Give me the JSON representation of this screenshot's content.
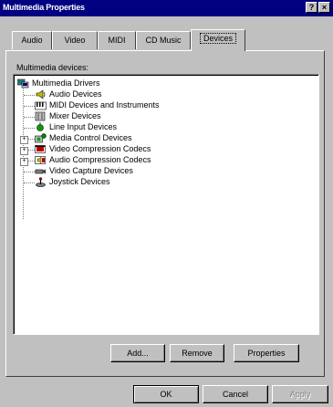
{
  "window": {
    "title": "Multimedia Properties",
    "help_label": "?",
    "close_label": "×"
  },
  "tabs": [
    {
      "label": "Audio"
    },
    {
      "label": "Video"
    },
    {
      "label": "MIDI"
    },
    {
      "label": "CD Music"
    },
    {
      "label": "Devices"
    }
  ],
  "active_tab": "Devices",
  "devices": {
    "label": "Multimedia devices:",
    "root": {
      "label": "Multimedia Drivers",
      "icon": "multimedia-drivers-icon"
    },
    "items": [
      {
        "label": "Audio Devices",
        "icon": "speaker-icon",
        "expandable": false
      },
      {
        "label": "MIDI Devices and Instruments",
        "icon": "midi-keyboard-icon",
        "expandable": false
      },
      {
        "label": "Mixer Devices",
        "icon": "mixer-icon",
        "expandable": false
      },
      {
        "label": "Line Input Devices",
        "icon": "line-input-icon",
        "expandable": false
      },
      {
        "label": "Media Control Devices",
        "icon": "media-control-icon",
        "expandable": true
      },
      {
        "label": "Video Compression Codecs",
        "icon": "video-codec-icon",
        "expandable": true
      },
      {
        "label": "Audio Compression Codecs",
        "icon": "audio-codec-icon",
        "expandable": true
      },
      {
        "label": "Video Capture Devices",
        "icon": "video-capture-icon",
        "expandable": false
      },
      {
        "label": "Joystick Devices",
        "icon": "joystick-icon",
        "expandable": false
      }
    ]
  },
  "buttons": {
    "add": "Add...",
    "remove": "Remove",
    "properties": "Properties",
    "ok": "OK",
    "cancel": "Cancel",
    "apply": "Apply"
  },
  "colors": {
    "titlebar": "#000080",
    "face": "#c0c0c0"
  }
}
